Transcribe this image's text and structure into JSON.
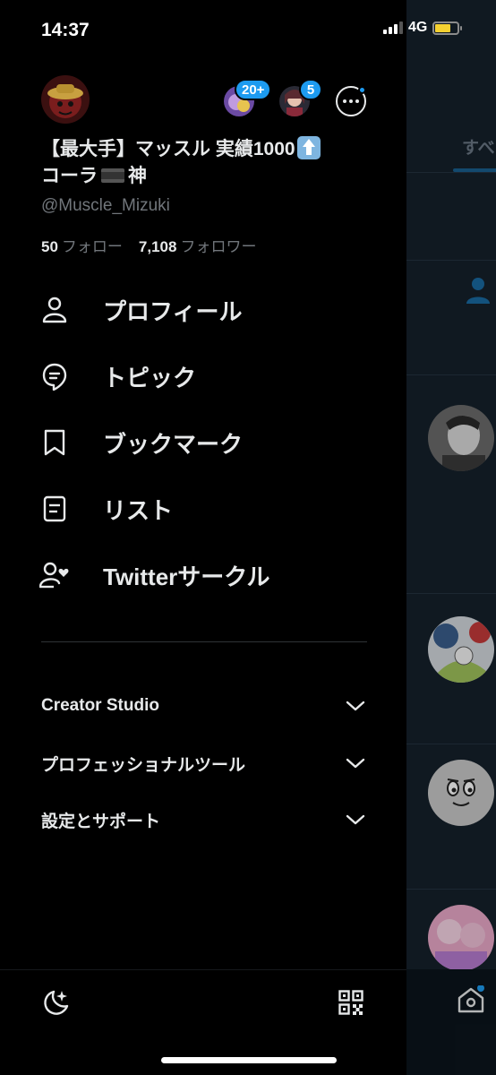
{
  "status_bar": {
    "time": "14:37",
    "network": "4G"
  },
  "accounts": {
    "badge_1": "20+",
    "badge_2": "5"
  },
  "profile": {
    "name_part1": "【最大手】マッスル 実績1000",
    "name_part2": "コーラ",
    "name_part3": "神",
    "handle": "@Muscle_Mizuki",
    "following_count": "50",
    "following_label": "フォロー",
    "followers_count": "7,108",
    "followers_label": "フォロワー"
  },
  "menu": [
    {
      "label": "プロフィール",
      "icon": "person-icon"
    },
    {
      "label": "トピック",
      "icon": "topics-icon"
    },
    {
      "label": "ブックマーク",
      "icon": "bookmark-icon"
    },
    {
      "label": "リスト",
      "icon": "list-icon"
    },
    {
      "label": "Twitterサークル",
      "icon": "circle-icon"
    }
  ],
  "sections": [
    {
      "label": "Creator Studio"
    },
    {
      "label": "プロフェッショナルツール"
    },
    {
      "label": "設定とサポート"
    }
  ],
  "background": {
    "tab_label": "すべ"
  },
  "colors": {
    "accent": "#1d9bf0",
    "background": "#000000",
    "text": "#e7e9ea",
    "muted": "#71767b"
  }
}
